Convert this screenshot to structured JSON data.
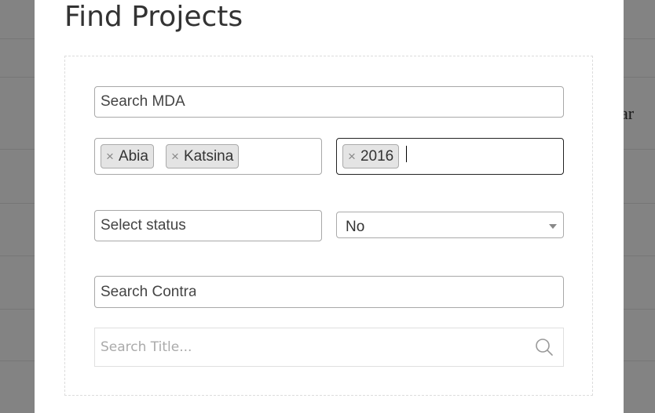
{
  "background": {
    "side_text": "ar"
  },
  "modal": {
    "title": "Find Projects",
    "mda_search": {
      "placeholder": "Search MDA",
      "value": ""
    },
    "states": {
      "tags": [
        {
          "remove": "×",
          "label": "Abia"
        },
        {
          "remove": "×",
          "label": "Katsina"
        }
      ]
    },
    "years": {
      "tags": [
        {
          "remove": "×",
          "label": "2016"
        }
      ]
    },
    "status": {
      "placeholder": "Select status",
      "value": ""
    },
    "flag_select": {
      "selected": "No"
    },
    "contractor_search": {
      "placeholder": "Search Contra",
      "value": ""
    },
    "title_search": {
      "placeholder": "Search Title...",
      "icon": "search-icon"
    }
  },
  "colors": {
    "overlay": "#838383",
    "modal_bg": "#ffffff",
    "field_border": "#a8a8a8",
    "tag_bg": "#e4e4e4",
    "focus_border": "#222222"
  }
}
